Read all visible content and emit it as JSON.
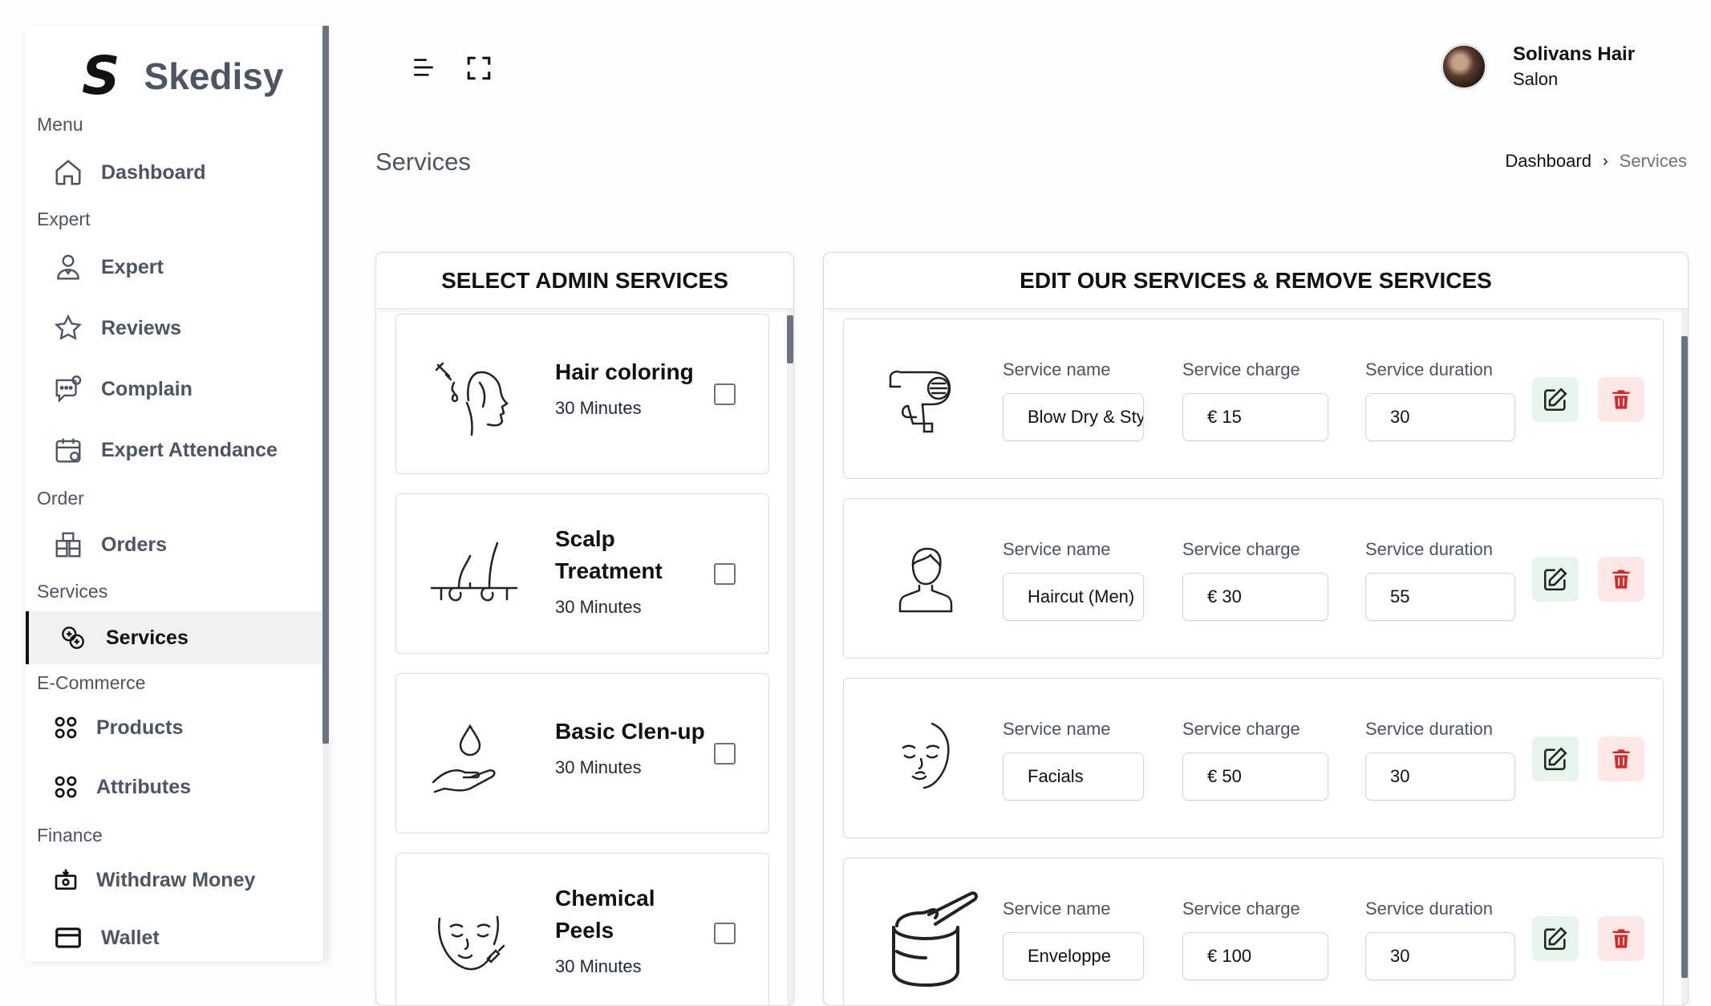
{
  "brand": {
    "logo_letter": "S",
    "name": "Skedisy"
  },
  "sidebar": {
    "sections": [
      {
        "title": "Menu",
        "items": [
          {
            "label": "Dashboard",
            "icon": "home-icon"
          }
        ]
      },
      {
        "title": "Expert",
        "items": [
          {
            "label": "Expert",
            "icon": "user-icon"
          },
          {
            "label": "Reviews",
            "icon": "star-icon"
          },
          {
            "label": "Complain",
            "icon": "chat-icon"
          },
          {
            "label": "Expert Attendance",
            "icon": "calendar-icon"
          }
        ]
      },
      {
        "title": "Order",
        "items": [
          {
            "label": "Orders",
            "icon": "boxes-icon"
          }
        ]
      },
      {
        "title": "Services",
        "items": [
          {
            "label": "Services",
            "icon": "services-icon",
            "active": true
          }
        ]
      },
      {
        "title": "E-Commerce",
        "items": [
          {
            "label": "Products",
            "icon": "grid-icon"
          },
          {
            "label": "Attributes",
            "icon": "grid-icon"
          }
        ]
      },
      {
        "title": "Finance",
        "items": [
          {
            "label": "Withdraw Money",
            "icon": "withdraw-icon"
          },
          {
            "label": "Wallet",
            "icon": "wallet-icon"
          }
        ]
      }
    ]
  },
  "header": {
    "profile_name": "Solivans Hair",
    "profile_role": "Salon"
  },
  "page": {
    "title": "Services",
    "breadcrumb": [
      "Dashboard",
      "Services"
    ]
  },
  "admin_panel": {
    "title": "SELECT ADMIN SERVICES",
    "services": [
      {
        "name": "Hair coloring",
        "duration": "30 Minutes",
        "icon": "hair-coloring-icon",
        "checked": false
      },
      {
        "name": "Scalp Treatment",
        "duration": "30 Minutes",
        "icon": "scalp-icon",
        "checked": false
      },
      {
        "name": "Basic Clen-up",
        "duration": "30 Minutes",
        "icon": "hand-drop-icon",
        "checked": false
      },
      {
        "name": "Chemical Peels",
        "duration": "30 Minutes",
        "icon": "face-peel-icon",
        "checked": false
      }
    ]
  },
  "edit_panel": {
    "title": "EDIT OUR SERVICES & REMOVE SERVICES",
    "labels": {
      "name": "Service name",
      "charge": "Service charge",
      "duration": "Service duration"
    },
    "services": [
      {
        "name": "Blow Dry & Style",
        "charge": "€ 15",
        "duration": "30",
        "icon": "hair-dryer-icon"
      },
      {
        "name": "Haircut (Men)",
        "charge": "€ 30",
        "duration": "55",
        "icon": "man-avatar-icon"
      },
      {
        "name": "Facials",
        "charge": "€ 50",
        "duration": "30",
        "icon": "face-icon"
      },
      {
        "name": "Enveloppe",
        "charge": "€ 100",
        "duration": "30",
        "icon": "wax-icon"
      }
    ]
  },
  "colors": {
    "edit_bg": "#e6f5ec",
    "delete_bg": "#fde8e8",
    "delete_icon": "#dc2626"
  }
}
